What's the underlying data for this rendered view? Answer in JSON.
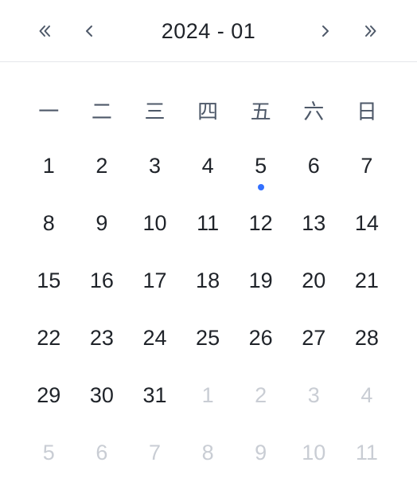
{
  "header": {
    "title": "2024 - 01",
    "prev_year_icon": "double-chevron-left-icon",
    "prev_month_icon": "chevron-left-icon",
    "next_month_icon": "chevron-right-icon",
    "next_year_icon": "double-chevron-right-icon"
  },
  "weekdays": [
    "一",
    "二",
    "三",
    "四",
    "五",
    "六",
    "日"
  ],
  "days": [
    {
      "label": "1",
      "muted": false
    },
    {
      "label": "2",
      "muted": false
    },
    {
      "label": "3",
      "muted": false
    },
    {
      "label": "4",
      "muted": false
    },
    {
      "label": "5",
      "muted": false,
      "marker": true
    },
    {
      "label": "6",
      "muted": false
    },
    {
      "label": "7",
      "muted": false
    },
    {
      "label": "8",
      "muted": false
    },
    {
      "label": "9",
      "muted": false
    },
    {
      "label": "10",
      "muted": false
    },
    {
      "label": "11",
      "muted": false
    },
    {
      "label": "12",
      "muted": false
    },
    {
      "label": "13",
      "muted": false
    },
    {
      "label": "14",
      "muted": false
    },
    {
      "label": "15",
      "muted": false
    },
    {
      "label": "16",
      "muted": false
    },
    {
      "label": "17",
      "muted": false
    },
    {
      "label": "18",
      "muted": false
    },
    {
      "label": "19",
      "muted": false
    },
    {
      "label": "20",
      "muted": false
    },
    {
      "label": "21",
      "muted": false
    },
    {
      "label": "22",
      "muted": false
    },
    {
      "label": "23",
      "muted": false
    },
    {
      "label": "24",
      "muted": false
    },
    {
      "label": "25",
      "muted": false
    },
    {
      "label": "26",
      "muted": false
    },
    {
      "label": "27",
      "muted": false
    },
    {
      "label": "28",
      "muted": false
    },
    {
      "label": "29",
      "muted": false
    },
    {
      "label": "30",
      "muted": false
    },
    {
      "label": "31",
      "muted": false
    },
    {
      "label": "1",
      "muted": true
    },
    {
      "label": "2",
      "muted": true
    },
    {
      "label": "3",
      "muted": true
    },
    {
      "label": "4",
      "muted": true
    },
    {
      "label": "5",
      "muted": true
    },
    {
      "label": "6",
      "muted": true
    },
    {
      "label": "7",
      "muted": true
    },
    {
      "label": "8",
      "muted": true
    },
    {
      "label": "9",
      "muted": true
    },
    {
      "label": "10",
      "muted": true
    },
    {
      "label": "11",
      "muted": true
    }
  ],
  "colors": {
    "text": "#1f2329",
    "muted_text": "#c9cdd4",
    "weekday_text": "#4e5969",
    "marker": "#3370ff",
    "divider": "#e5e6eb"
  }
}
